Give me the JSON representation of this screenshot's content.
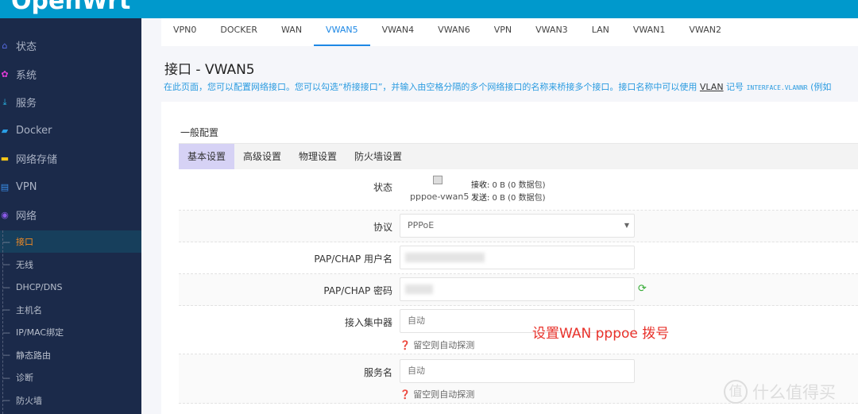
{
  "header": {
    "logo": "OpenWrt",
    "color": "#0099cc"
  },
  "sidebar": {
    "menu": [
      {
        "label": "状态",
        "icon": "home-icon",
        "color": "#5a6ee8"
      },
      {
        "label": "系统",
        "icon": "gear-icon",
        "color": "#e23cd8"
      },
      {
        "label": "服务",
        "icon": "download-icon",
        "color": "#2ab5e6"
      },
      {
        "label": "Docker",
        "icon": "docker-icon",
        "color": "#2a9ee6"
      },
      {
        "label": "网络存储",
        "icon": "storage-icon",
        "color": "#f5c518"
      },
      {
        "label": "VPN",
        "icon": "vpn-icon",
        "color": "#3a8ee8"
      },
      {
        "label": "网络",
        "icon": "globe-icon",
        "color": "#8a5ae8"
      }
    ],
    "sub": [
      "接口",
      "无线",
      "DHCP/DNS",
      "主机名",
      "IP/MAC绑定",
      "静态路由",
      "诊断",
      "防火墙"
    ],
    "active_sub": "接口"
  },
  "tabs": [
    "VPN0",
    "DOCKER",
    "WAN",
    "VWAN5",
    "VWAN4",
    "VWAN6",
    "VPN",
    "VWAN3",
    "LAN",
    "VWAN1",
    "VWAN2"
  ],
  "active_tab": "VWAN5",
  "page": {
    "title": "接口 - VWAN5",
    "desc_a": "在此页面，您可以配置网络接口。您可以勾选“桥接接口”，并输入由空格分隔的多个网络接口的名称来桥接多个接口。接口名称中可以使用 ",
    "desc_link": "VLAN",
    "desc_b": " 记号 ",
    "desc_code": "INTERFACE.VLANNR",
    "desc_c": " (例如"
  },
  "section": "一般配置",
  "subtabs": [
    "基本设置",
    "高级设置",
    "物理设置",
    "防火墙设置"
  ],
  "form": {
    "status_label": "状态",
    "device": "pppoe-vwan5",
    "rx_label": "接收:",
    "rx": " 0 B (0 数据包)",
    "tx_label": "发送:",
    "tx": " 0 B (0 数据包)",
    "protocol_label": "协议",
    "protocol": "PPPoE",
    "user_label": "PAP/CHAP 用户名",
    "pass_label": "PAP/CHAP 密码",
    "ac_label": "接入集中器",
    "ac_placeholder": "自动",
    "ac_hint": "留空则自动探测",
    "service_label": "服务名",
    "service_placeholder": "自动",
    "service_hint": "留空则自动探测"
  },
  "annotation": "设置WAN pppoe 拨号",
  "watermark": {
    "badge": "值",
    "text": "什么值得买"
  }
}
